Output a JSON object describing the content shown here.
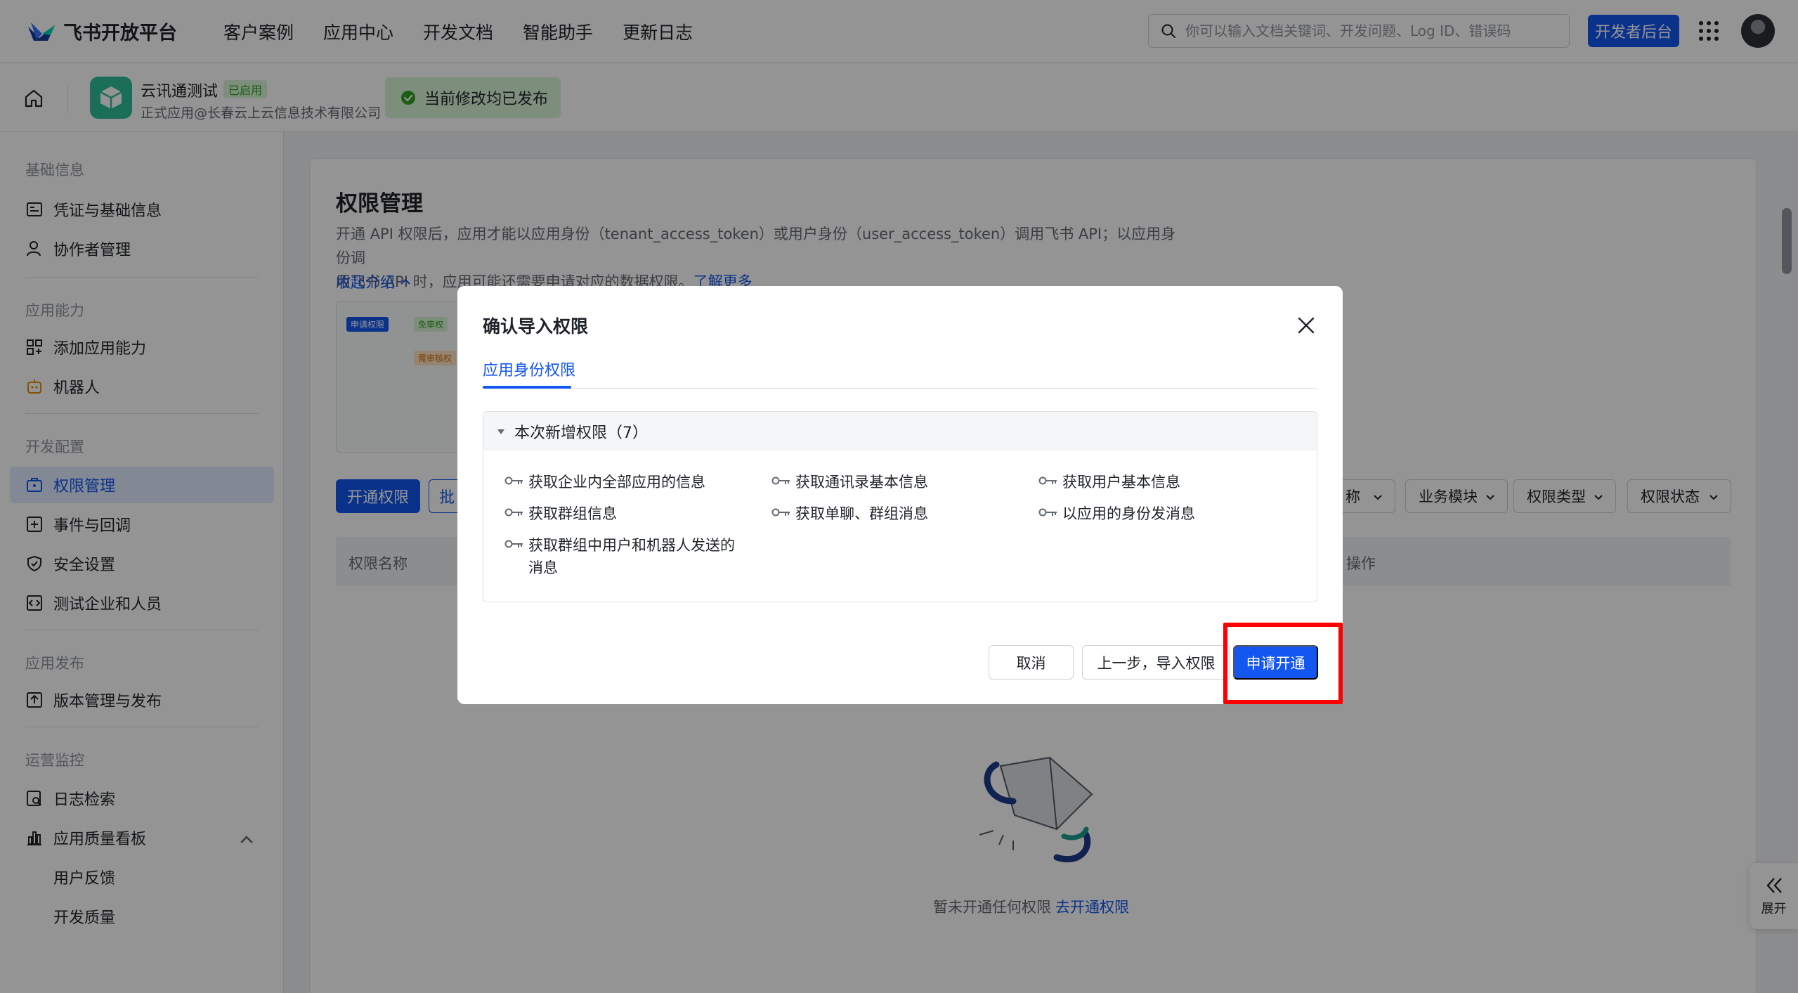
{
  "topnav": {
    "brand": "飞书开放平台",
    "links": [
      "客户案例",
      "应用中心",
      "开发文档",
      "智能助手",
      "更新日志"
    ],
    "search_placeholder": "你可以输入文档关键词、开发问题、Log ID、错误码",
    "dev_console": "开发者后台"
  },
  "appbar": {
    "app_name": "云讯通测试",
    "app_status": "已启用",
    "app_company": "正式应用@长春云上云信息技术有限公司",
    "publish_status": "当前修改均已发布"
  },
  "sidebar": {
    "sections": [
      {
        "title": "基础信息",
        "items": [
          "凭证与基础信息",
          "协作者管理"
        ]
      },
      {
        "title": "应用能力",
        "items": [
          "添加应用能力",
          "机器人"
        ]
      },
      {
        "title": "开发配置",
        "items": [
          "权限管理",
          "事件与回调",
          "安全设置",
          "测试企业和人员"
        ]
      },
      {
        "title": "应用发布",
        "items": [
          "版本管理与发布"
        ]
      },
      {
        "title": "运营监控",
        "items": [
          "日志检索",
          "应用质量看板",
          "用户反馈",
          "开发质量"
        ]
      }
    ]
  },
  "main": {
    "title": "权限管理",
    "desc_line1": "开通 API 权限后，应用才能以应用身份（tenant_access_token）或用户身份（user_access_token）调用飞书 API；以应用身份调",
    "desc_line2": "用飞书 API 时，应用可能还需要申请对应的数据权限。",
    "learn_more": "了解更多",
    "collapse": "收起介绍",
    "diagram_tag1": "申请权限",
    "diagram_tag2": "免审权",
    "diagram_tag3": "需审核权",
    "open_perm_button": "开通权限",
    "batch_button": "批",
    "filters": [
      "称",
      "业务模块",
      "权限类型",
      "权限状态"
    ],
    "table_headers": [
      "权限名称",
      "操作"
    ],
    "empty_text": "暂未开通任何权限",
    "empty_link": "去开通权限",
    "expand": "展开"
  },
  "modal": {
    "title": "确认导入权限",
    "tab": "应用身份权限",
    "group_title": "本次新增权限（7）",
    "permissions": [
      "获取企业内全部应用的信息",
      "获取通讯录基本信息",
      "获取用户基本信息",
      "获取群组信息",
      "获取单聊、群组消息",
      "以应用的身份发消息",
      "获取群组中用户和机器人发送的消息"
    ],
    "cancel": "取消",
    "back": "上一步，导入权限",
    "apply": "申请开通"
  },
  "colors": {
    "primary": "#1456f0",
    "success_bg": "#d9f5d6",
    "highlight": "#ff0000"
  }
}
